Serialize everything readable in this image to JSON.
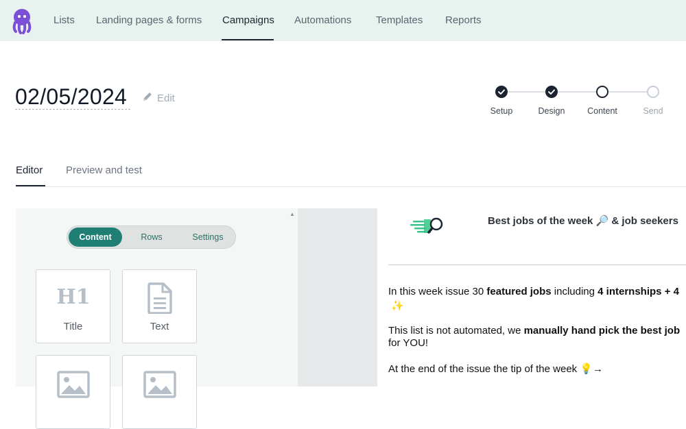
{
  "nav": {
    "items": [
      {
        "label": "Lists"
      },
      {
        "label": "Landing pages & forms"
      },
      {
        "label": "Campaigns"
      },
      {
        "label": "Automations"
      },
      {
        "label": "Templates"
      },
      {
        "label": "Reports"
      }
    ],
    "active": "Campaigns"
  },
  "campaign": {
    "title": "02/05/2024",
    "edit_label": "Edit"
  },
  "stepper": {
    "steps": [
      {
        "label": "Setup",
        "state": "done"
      },
      {
        "label": "Design",
        "state": "done"
      },
      {
        "label": "Content",
        "state": "current"
      },
      {
        "label": "Send",
        "state": "todo"
      }
    ]
  },
  "tabs": [
    {
      "label": "Editor"
    },
    {
      "label": "Preview and test"
    }
  ],
  "panel": {
    "segments": [
      {
        "label": "Content"
      },
      {
        "label": "Rows"
      },
      {
        "label": "Settings"
      }
    ],
    "blocks": [
      {
        "label": "Title",
        "icon": "heading-h1-icon"
      },
      {
        "label": "Text",
        "icon": "document-icon"
      },
      {
        "label": "",
        "icon": "image-icon"
      },
      {
        "label": "",
        "icon": "image-icon"
      }
    ]
  },
  "email": {
    "headline_a": "Best jobs of the week",
    "headline_emoji": "🔎",
    "headline_b": "& job seekers",
    "p1_a": "In this week issue 30 ",
    "p1_b": "featured jobs",
    "p1_c": " including ",
    "p1_d": "4 internships + 4",
    "p1_emoji": "✨",
    "p2_a": "This list is not automated, we ",
    "p2_b": "manually hand pick the best job",
    "p2_c": "for YOU!",
    "p3_a": "At the end of the issue the tip of the week",
    "p3_emoji": "💡→"
  },
  "colors": {
    "nav_bg": "#e8f3ef",
    "accent": "#1f7f75",
    "dark": "#1b2330",
    "logo": "#7b4fd6"
  }
}
